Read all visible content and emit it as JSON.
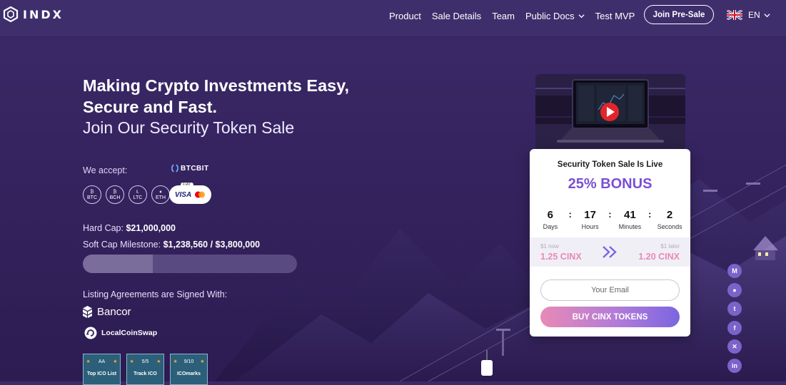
{
  "header": {
    "logo_text": "INDX",
    "nav": [
      {
        "label": "Product"
      },
      {
        "label": "Sale Details"
      },
      {
        "label": "Team"
      },
      {
        "label": "Public Docs"
      },
      {
        "label": "Test MVP"
      }
    ],
    "presale_label": "Join Pre-Sale",
    "language": "EN"
  },
  "hero": {
    "title": "Making Crypto Investments Easy, Secure and Fast.",
    "subtitle": "Join Our Security Token Sale"
  },
  "payments": {
    "label": "We accept:",
    "btcbit": "BTCBIT",
    "coins": [
      "BTC",
      "BCH",
      "LTC",
      "ETH"
    ],
    "fiat_tag": "FIAT",
    "visa": "VISA"
  },
  "caps": {
    "hard_label": "Hard Cap:",
    "hard_value": "$21,000,000",
    "soft_label": "Soft Cap Milestone:",
    "soft_value": "$1,238,560 / $3,800,000",
    "progress_fraction": 0.326
  },
  "listing": {
    "label": "Listing Agreements are Signed With:",
    "partners": [
      "Bancor",
      "LocalCoinSwap"
    ]
  },
  "ratings": [
    {
      "score": "AA",
      "name": "Top ICO List"
    },
    {
      "score": "5/5",
      "name": "Track ICO"
    },
    {
      "score": "9/10",
      "name": "ICOmarks"
    }
  ],
  "sale_card": {
    "title": "Security Token Sale Is Live",
    "bonus": "25% BONUS",
    "countdown": [
      {
        "value": "6",
        "label": "Days"
      },
      {
        "value": "17",
        "label": "Hours"
      },
      {
        "value": "41",
        "label": "Minutes"
      },
      {
        "value": "2",
        "label": "Seconds"
      }
    ],
    "price_now_label": "$1 now",
    "price_now": "1.25 CINX",
    "price_later_label": "$1 later",
    "price_later": "1.20 CINX",
    "email_placeholder": "Your Email",
    "buy_label": "BUY CINX TOKENS"
  },
  "social_icons": [
    "medium-icon",
    "reddit-icon",
    "twitter-icon",
    "facebook-icon",
    "xing-icon",
    "linkedin-icon"
  ],
  "colors": {
    "background": "#35235f",
    "header": "#3e2f6c",
    "accent_purple": "#7a4fd6",
    "price_pink": "#e88ab5"
  }
}
